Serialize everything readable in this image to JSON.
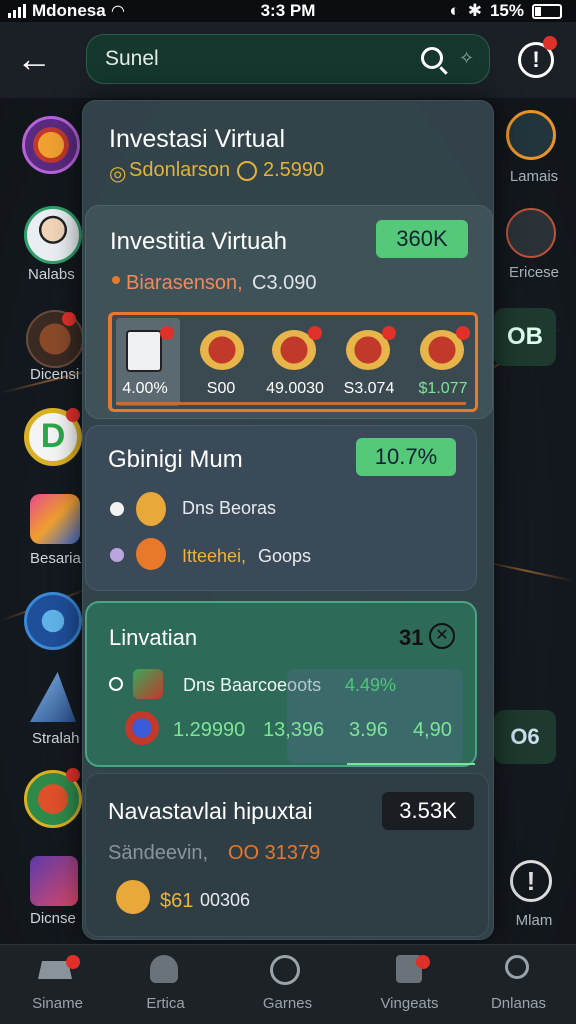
{
  "status_bar": {
    "carrier": "Mdonesa",
    "time": "3:3 PM",
    "battery": "15%"
  },
  "search": {
    "value": "Sunel"
  },
  "header": {
    "back_label": "←"
  },
  "left_rail": [
    {
      "label": ""
    },
    {
      "label": "Nalabs"
    },
    {
      "label": "Dicensi"
    },
    {
      "label": ""
    },
    {
      "label": "Besaria"
    },
    {
      "label": ""
    },
    {
      "label": "Stralah"
    },
    {
      "label": ""
    },
    {
      "label": "Dicnse"
    }
  ],
  "right_rail": [
    {
      "label": "Lamais"
    },
    {
      "label": "Ericese"
    },
    {
      "label": "OB"
    },
    {
      "label": "O6"
    },
    {
      "label": "Mlam"
    }
  ],
  "panel": {
    "header": {
      "title": "Investasi Virtual",
      "subtitle": "Sdonlarson",
      "sub_value": "2.5990"
    },
    "card1": {
      "title": "Investitia Virtuah",
      "badge": "360K",
      "sub_label": "Biarasenson,",
      "sub_value": "C3.090",
      "tokens": [
        {
          "value": "4.00%"
        },
        {
          "value": "S00"
        },
        {
          "value": "49.0030"
        },
        {
          "value": "S3.074"
        },
        {
          "value": "$1.077"
        }
      ]
    },
    "card2": {
      "title": "Gbinigi Mum",
      "badge": "10.7%",
      "rows": [
        {
          "label": "Dns Beoras"
        },
        {
          "label": "Itteehei,",
          "extra": "Goops"
        }
      ]
    },
    "card3": {
      "title": "Linvatian",
      "badge": "31",
      "row_label": "Dns Baarcoeoots",
      "row_pct": "4.49%",
      "values": [
        "1.29990",
        "13,396",
        "3.96",
        "4,90"
      ]
    },
    "card4": {
      "title": "Navastavlai hipuxtai",
      "badge": "3.53K",
      "sub_label": "Sändeevin,",
      "sub_value": "OO 31379",
      "coin_value": "$61",
      "coin_value2": "00306"
    }
  },
  "bottom_nav": [
    {
      "label": "Siname"
    },
    {
      "label": "Ertica"
    },
    {
      "label": "Garnes"
    },
    {
      "label": "Vingeats"
    },
    {
      "label": "Dnlanas"
    }
  ],
  "colors": {
    "accent_green": "#4fc776",
    "accent_orange": "#e8782a",
    "panel": "#36464e",
    "alert_red": "#e0302a"
  }
}
